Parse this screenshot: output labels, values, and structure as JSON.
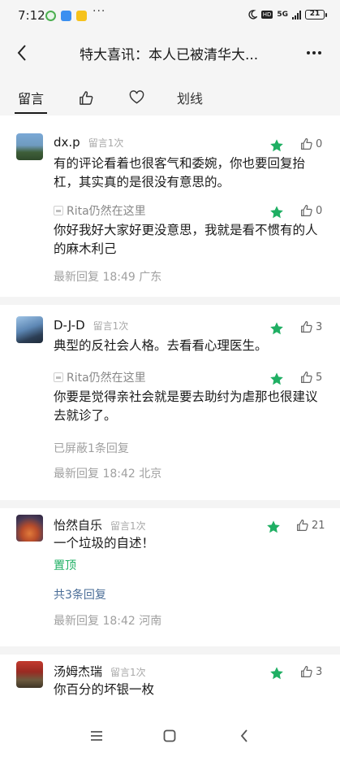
{
  "status": {
    "time": "7:12",
    "dots": "···",
    "hd": "HD",
    "network": "5G",
    "battery": "21",
    "battery_level": 0.21,
    "colors": {
      "app1": "#4caf50",
      "app2": "#3b8ff0",
      "app3": "#f0b400",
      "battery_fill": "#f1d04b"
    }
  },
  "header": {
    "title": "特大喜讯：本人已被清华大..."
  },
  "tabs": [
    {
      "label": "留言",
      "active": true
    },
    {
      "icon": "thumb-up-icon"
    },
    {
      "icon": "heart-icon"
    },
    {
      "label": "划线"
    }
  ],
  "accent": "#1faf63",
  "link_color": "#4a6d97",
  "comments": [
    {
      "user": "dx.p",
      "badge": "留言1次",
      "likes": "0",
      "text": "有的评论看着也很客气和委婉，你也要回复抬杠，其实真的是很没有意思的。",
      "reply": {
        "user": "Rita仍然在这里",
        "likes": "0",
        "text": "你好我好大家好更没意思，我就是看不惯有的人的麻木利己"
      },
      "meta": "最新回复 18:49  广东"
    },
    {
      "user": "D-J-D",
      "badge": "留言1次",
      "likes": "3",
      "text": "典型的反社会人格。去看看心理医生。",
      "reply": {
        "user": "Rita仍然在这里",
        "likes": "5",
        "text": "你要是觉得亲社会就是要去助纣为虐那也很建议去就诊了。"
      },
      "hidden_note": "已屏蔽1条回复",
      "meta": "最新回复 18:42  北京"
    },
    {
      "user": "怡然自乐",
      "badge": "留言1次",
      "likes": "21",
      "text": "一个垃圾的自述！",
      "pinned": "置顶",
      "replies_link": "共3条回复",
      "meta": "最新回复 18:42  河南"
    },
    {
      "user": "汤姆杰瑞",
      "badge": "留言1次",
      "likes": "3",
      "text": "你百分的坏银一枚"
    }
  ],
  "bottom_nav": [
    "menu-icon",
    "home-square-icon",
    "back-chevron-icon"
  ]
}
